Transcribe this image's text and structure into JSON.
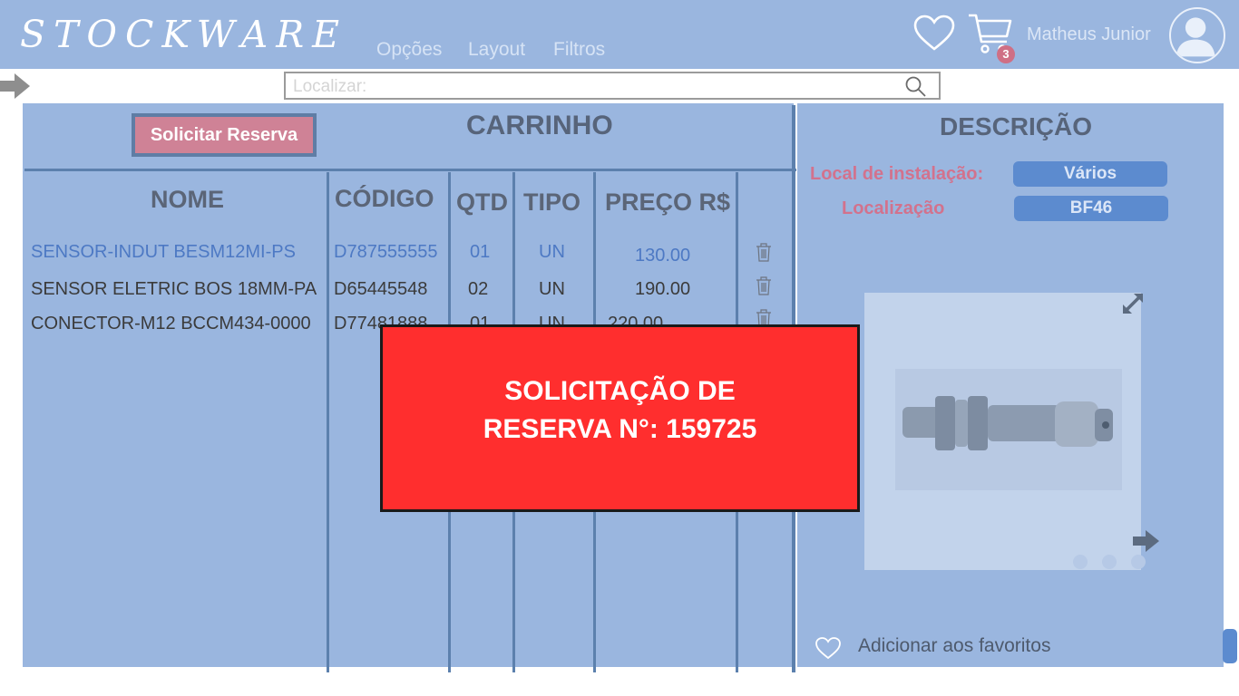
{
  "header": {
    "logo": "STOCKWARE",
    "menu": [
      "Opções",
      "Layout",
      "Filtros"
    ],
    "cart_count": "3",
    "user_name": "Matheus Junior"
  },
  "search": {
    "placeholder": "Localizar:"
  },
  "cart": {
    "reserve_button": "Solicitar Reserva",
    "title": "CARRINHO",
    "columns": [
      "NOME",
      "CÓDIGO",
      "QTD",
      "TIPO",
      "PREÇO R$"
    ],
    "rows": [
      {
        "name": "SENSOR-INDUT BESM12MI-PS",
        "code": "D787555555",
        "qty": "01",
        "type": "UN",
        "price": "130.00",
        "selected": true
      },
      {
        "name": "SENSOR ELETRIC BOS 18MM-PA",
        "code": "D65445548",
        "qty": "02",
        "type": "UN",
        "price": "190.00",
        "selected": false
      },
      {
        "name": "CONECTOR-M12 BCCM434-0000",
        "code": "D77481888",
        "qty": "01",
        "type": "UN",
        "price": "220.00",
        "selected": false
      }
    ]
  },
  "description": {
    "title": "DESCRIÇÃO",
    "fields": [
      {
        "label": "Local de instalação:",
        "value": "Vários"
      },
      {
        "label": "Localização",
        "value": "BF46"
      }
    ],
    "favorite_label": "Adicionar aos favoritos"
  },
  "modal": {
    "line1": "SOLICITAÇÃO DE",
    "line2": "RESERVA N°: 159725"
  },
  "colors": {
    "panel": "#9ab6df",
    "accent_pink": "#d2728d",
    "modal_red": "#ff2e2e",
    "pill_blue": "#5c8bcf"
  },
  "icons": [
    "heart-icon",
    "cart-icon",
    "user-avatar-icon",
    "arrow-right-icon",
    "search-icon",
    "trash-icon",
    "expand-icon",
    "next-arrow-icon"
  ]
}
